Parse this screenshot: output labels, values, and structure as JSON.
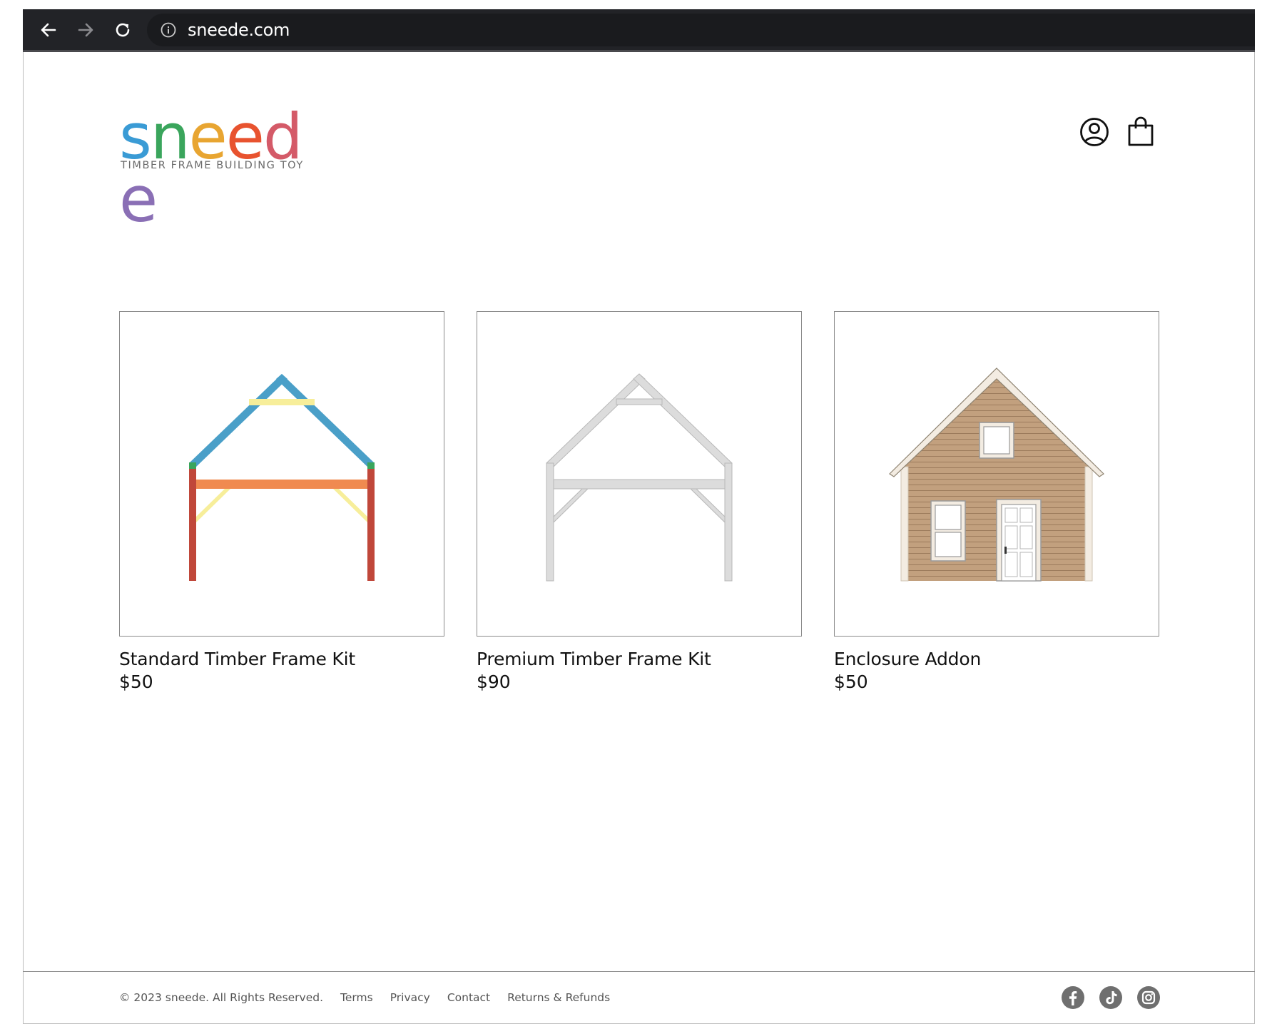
{
  "browser": {
    "url": "sneede.com",
    "icons": [
      "back-arrow-icon",
      "forward-arrow-icon",
      "reload-icon",
      "info-icon"
    ]
  },
  "header": {
    "logo": {
      "letters": [
        "s",
        "n",
        "e",
        "e",
        "d",
        "e"
      ],
      "letter_colors": [
        "#3a9bd5",
        "#3aa55c",
        "#e8a531",
        "#e8532f",
        "#d45a68",
        "#8a6fb5"
      ],
      "tagline": "TIMBER  FRAME BUILDING TOY"
    },
    "icons": [
      "account-icon",
      "shopping-bag-icon"
    ]
  },
  "products": [
    {
      "name": "Standard Timber Frame Kit",
      "price": "$50",
      "image": "colored-timber-frame"
    },
    {
      "name": "Premium Timber Frame Kit",
      "price": "$90",
      "image": "gray-timber-frame"
    },
    {
      "name": "Enclosure Addon",
      "price": "$50",
      "image": "house-enclosure"
    }
  ],
  "footer": {
    "copyright": "© 2023 sneede. All Rights Reserved.",
    "links": [
      "Terms",
      "Privacy",
      "Contact",
      "Returns & Refunds"
    ],
    "social_icons": [
      "facebook-icon",
      "tiktok-icon",
      "instagram-icon"
    ]
  },
  "colors": {
    "chrome_bg": "#222327",
    "frame_blue": "#4a9fc8",
    "frame_red": "#c0473a",
    "frame_orange": "#f08a50",
    "frame_yellow": "#f7ee9a",
    "frame_gray": "#d2d2d2",
    "siding": "#c2a07e"
  }
}
